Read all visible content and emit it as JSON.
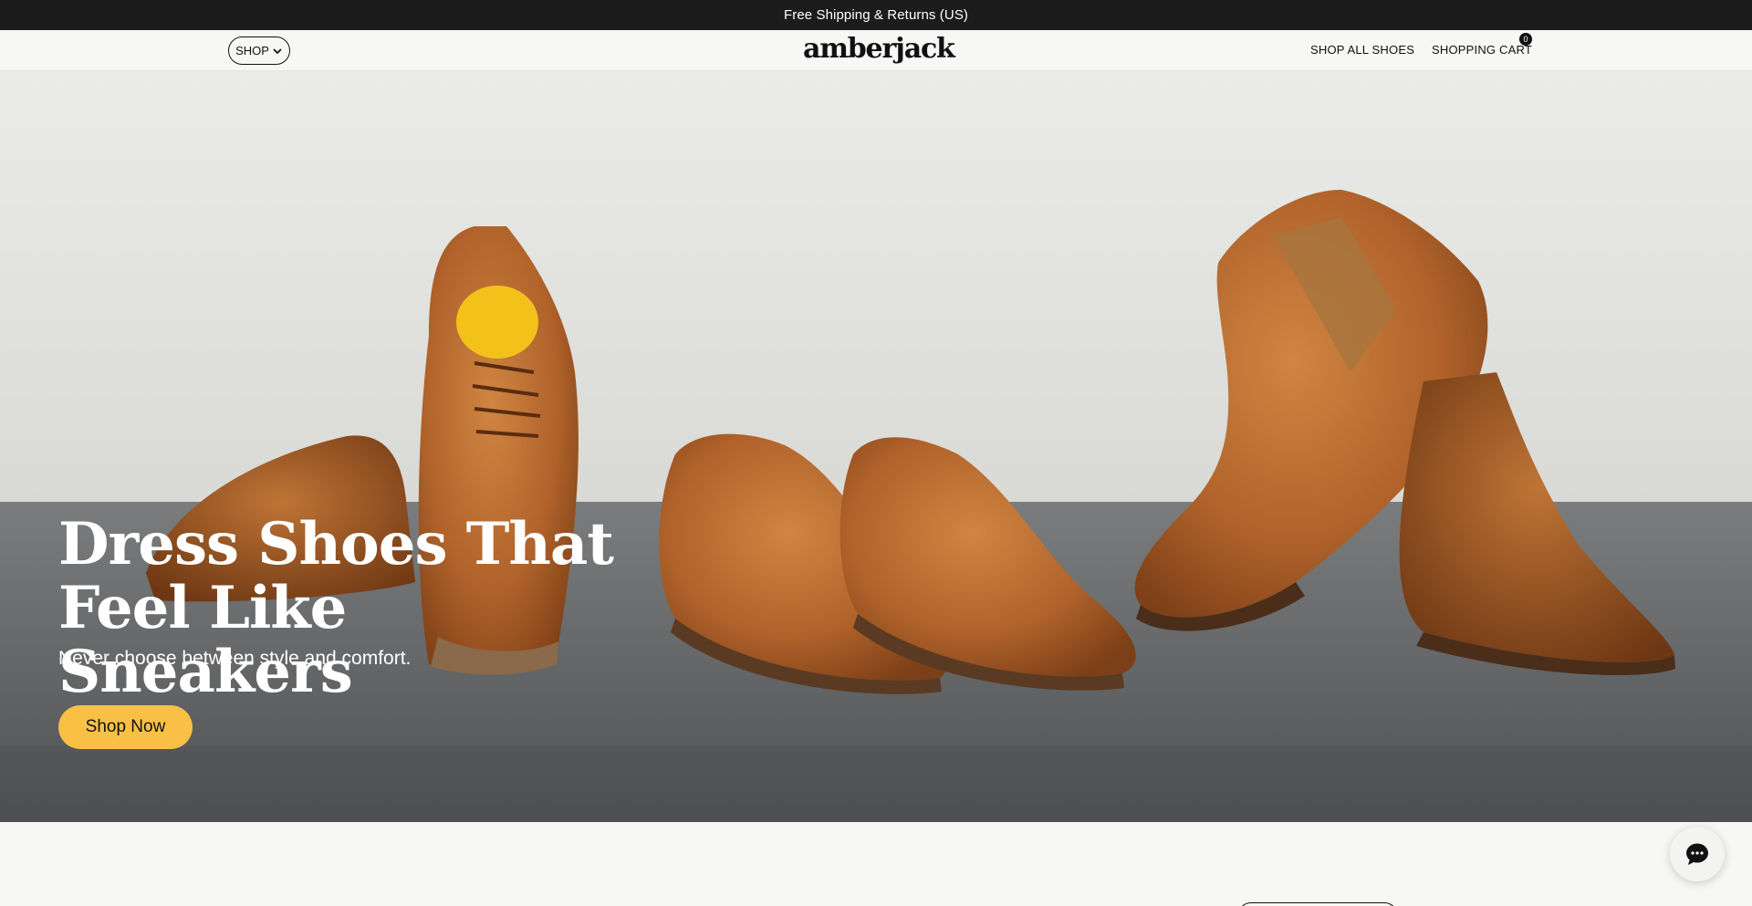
{
  "announcement": "Free Shipping & Returns (US)",
  "header": {
    "shop_label": "SHOP",
    "logo": "amberjack",
    "nav": {
      "shop_all": "SHOP ALL SHOES",
      "cart": "SHOPPING CART"
    },
    "cart_count": "0"
  },
  "hero": {
    "title": "Dress Shoes That Feel Like Sneakers",
    "subtitle": "Never choose between style and comfort.",
    "cta": "Shop Now"
  },
  "colors": {
    "accent": "#f8c145",
    "announcement_bg": "#1c1c1c",
    "page_bg": "#f7f7f6",
    "leather": "#b86a2e"
  },
  "icons": {
    "shop_menu": "chevron-down-icon",
    "chat": "chat-bubble-icon"
  }
}
